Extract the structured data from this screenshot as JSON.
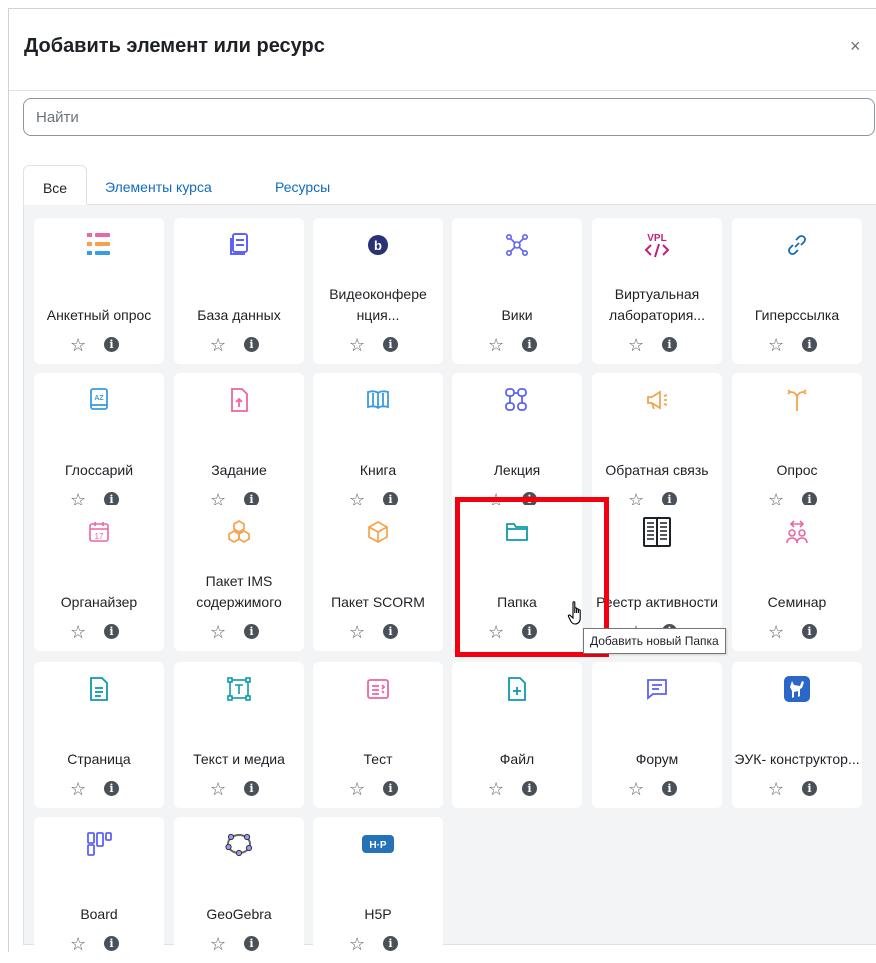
{
  "modal": {
    "title": "Добавить элемент или ресурс",
    "close_label": "×",
    "search_placeholder": "Найти",
    "tabs": [
      {
        "label": "Все",
        "active": true
      },
      {
        "label": "Элементы курса",
        "active": false
      },
      {
        "label": "Ресурсы",
        "active": false
      }
    ]
  },
  "modules": [
    {
      "name": "Анкетный опрос",
      "icon": "survey-icon"
    },
    {
      "name": "База данных",
      "icon": "database-icon"
    },
    {
      "name": "Видеоконфере нция...",
      "icon": "bigbluebutton-icon"
    },
    {
      "name": "Вики",
      "icon": "wiki-icon"
    },
    {
      "name": "Виртуальная лаборатория...",
      "icon": "vpl-icon"
    },
    {
      "name": "Гиперссылка",
      "icon": "link-icon"
    },
    {
      "name": "Глоссарий",
      "icon": "glossary-icon"
    },
    {
      "name": "Задание",
      "icon": "assignment-icon"
    },
    {
      "name": "Книга",
      "icon": "book-icon"
    },
    {
      "name": "Лекция",
      "icon": "lesson-icon"
    },
    {
      "name": "Обратная связь",
      "icon": "feedback-icon"
    },
    {
      "name": "Опрос",
      "icon": "choice-icon"
    },
    {
      "name": "Органайзер",
      "icon": "calendar-icon"
    },
    {
      "name": "Пакет IMS содержимого",
      "icon": "ims-package-icon"
    },
    {
      "name": "Пакет SCORM",
      "icon": "scorm-icon"
    },
    {
      "name": "Папка",
      "icon": "folder-icon"
    },
    {
      "name": "Реестр активности",
      "icon": "activity-registry-icon"
    },
    {
      "name": "Семинар",
      "icon": "workshop-icon"
    },
    {
      "name": "Страница",
      "icon": "page-icon"
    },
    {
      "name": "Текст и медиа",
      "icon": "text-media-icon"
    },
    {
      "name": "Тест",
      "icon": "quiz-icon"
    },
    {
      "name": "Файл",
      "icon": "file-icon"
    },
    {
      "name": "Форум",
      "icon": "forum-icon"
    },
    {
      "name": "ЭУК- конструктор...",
      "icon": "euk-builder-icon"
    },
    {
      "name": "Board",
      "icon": "board-icon"
    },
    {
      "name": "GeoGebra",
      "icon": "geogebra-icon"
    },
    {
      "name": "H5P",
      "icon": "h5p-icon"
    }
  ],
  "tooltip": "Добавить новый Папка",
  "icons": {
    "star": "star-outline-icon",
    "info": "info-icon"
  },
  "colors": {
    "link": "#0f6cbf",
    "highlight": "#f2000f",
    "panel": "#f3f4f6"
  }
}
